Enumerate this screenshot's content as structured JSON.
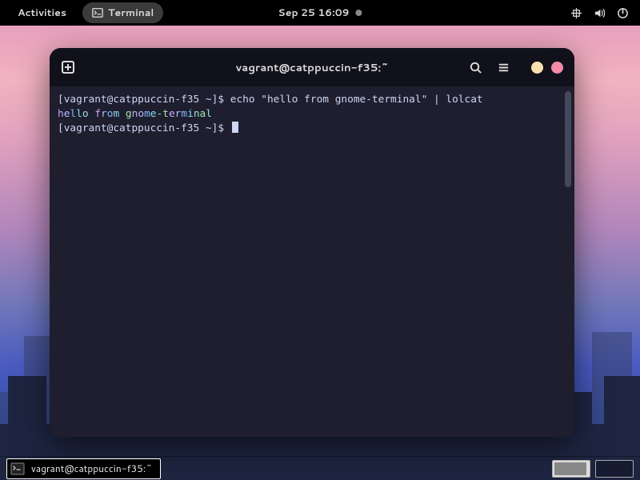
{
  "topbar": {
    "activities": "Activities",
    "terminal_button": "Terminal",
    "clock": "Sep 25  16:09"
  },
  "terminal": {
    "title": "vagrant@catppuccin-f35:~",
    "prompt1": "[vagrant@catppuccin-f35 ~]$ ",
    "command1": "echo \"hello from gnome-terminal\" | lolcat",
    "output": "hello from gnome-terminal",
    "prompt2": "[vagrant@catppuccin-f35 ~]$ "
  },
  "dash": {
    "task_label": "vagrant@catppuccin-f35:~"
  }
}
